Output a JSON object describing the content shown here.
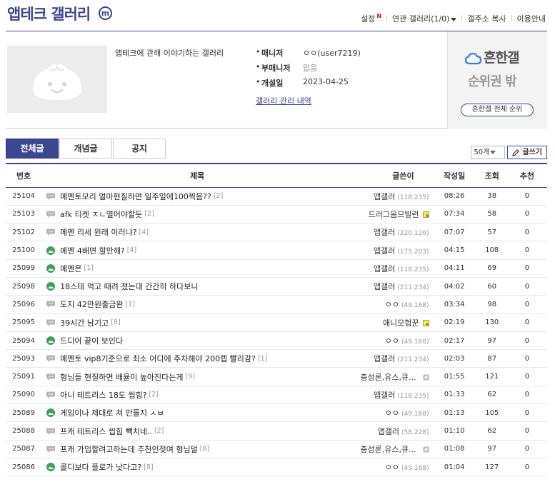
{
  "header": {
    "title": "앱테크 갤러리",
    "minor_badge": "m",
    "links": {
      "settings": "설정",
      "settings_badge": "N",
      "related": "연관 갤러리(1/0)",
      "copy_url": "갤주소 복사",
      "guide": "이용안내"
    }
  },
  "info": {
    "description": "앱테크에 관해 이야기하는 갤러리",
    "manager_label": "매니저",
    "manager_value": "ㅇㅇ(user7219)",
    "submanager_label": "부매니저",
    "submanager_value": "없음",
    "opened_label": "개설일",
    "opened_value": "2023-04-25",
    "manage_link": "갤러리 관리 내역"
  },
  "ranking": {
    "logo_text": "흔한갤",
    "rank_text": "순위권 밖",
    "button": "흔한갤 전체 순위"
  },
  "tabs": [
    {
      "label": "전체글",
      "active": true
    },
    {
      "label": "개념글",
      "active": false
    },
    {
      "label": "공지",
      "active": false
    }
  ],
  "list_tools": {
    "count": "50개",
    "write": "글쓰기"
  },
  "columns": {
    "num": "번호",
    "title": "제목",
    "writer": "글쓴이",
    "date": "작성일",
    "views": "조회",
    "recommend": "추천"
  },
  "colors": {
    "accent": "#3b4890",
    "green_icon": "#3ea05c",
    "gray_icon": "#b5b5b5"
  },
  "posts": [
    {
      "num": "25104",
      "icon": "text",
      "title": "메멘토모리 얼마현질하면 일주일에100찍음??",
      "replies": "[2]",
      "nick": "앱갤러",
      "ip": "(118.235)",
      "badge": "",
      "date": "08:26",
      "views": "38",
      "rec": "0"
    },
    {
      "num": "25103",
      "icon": "text",
      "title": "afk 티켓 ㅈㄴ열어야할듯",
      "replies": "[2]",
      "nick": "드러그옴므빌런",
      "ip": "",
      "badge": "fixed",
      "date": "07:34",
      "views": "58",
      "rec": "0"
    },
    {
      "num": "25102",
      "icon": "text",
      "title": "메멘 리세 원래 이러냐?",
      "replies": "[4]",
      "nick": "앱갤러",
      "ip": "(220.126)",
      "badge": "",
      "date": "07:07",
      "views": "57",
      "rec": "0"
    },
    {
      "num": "25100",
      "icon": "image",
      "title": "메멘 4배면 할만해?",
      "replies": "[4]",
      "nick": "앱갤러",
      "ip": "(175.203)",
      "badge": "",
      "date": "04:15",
      "views": "108",
      "rec": "0"
    },
    {
      "num": "25099",
      "icon": "image",
      "title": "메멘은",
      "replies": "[1]",
      "nick": "앱갤러",
      "ip": "(118.235)",
      "badge": "",
      "date": "04:11",
      "views": "69",
      "rec": "0"
    },
    {
      "num": "25098",
      "icon": "image",
      "title": "18스테 먹고 때려 쳤는대 간간히 하다보니",
      "replies": "",
      "nick": "앱갤러",
      "ip": "(211.234)",
      "badge": "",
      "date": "04:02",
      "views": "60",
      "rec": "0"
    },
    {
      "num": "25096",
      "icon": "text",
      "title": "도지 42만원출금완",
      "replies": "[1]",
      "nick": "ㅇㅇ",
      "ip": "(49.168)",
      "badge": "",
      "date": "03:34",
      "views": "98",
      "rec": "0"
    },
    {
      "num": "25095",
      "icon": "text",
      "title": "39시간 남기고",
      "replies": "[8]",
      "nick": "애니모험꾼",
      "ip": "",
      "badge": "fixed",
      "date": "02:19",
      "views": "130",
      "rec": "0"
    },
    {
      "num": "25094",
      "icon": "image",
      "title": "드디어 끝이 보인다",
      "replies": "",
      "nick": "ㅇㅇ",
      "ip": "(49.168)",
      "badge": "",
      "date": "02:17",
      "views": "97",
      "rec": "0"
    },
    {
      "num": "25093",
      "icon": "text",
      "title": "메멘토 vip8기준으로 최소 어디에 주차해야 200렙 빨리감?",
      "replies": "[1]",
      "nick": "앱갤러",
      "ip": "(211.234)",
      "badge": "",
      "date": "02:03",
      "views": "87",
      "rec": "0"
    },
    {
      "num": "25091",
      "icon": "text",
      "title": "형님들 현질하면 배율이 높아진다는게",
      "replies": "[9]",
      "nick": "충성론,유스,큐...",
      "ip": "",
      "badge": "half",
      "date": "01:55",
      "views": "121",
      "rec": "0"
    },
    {
      "num": "25090",
      "icon": "text",
      "title": "아니 테트리스 18도 씹힘?",
      "replies": "[2]",
      "nick": "앱갤러",
      "ip": "(118.235)",
      "badge": "",
      "date": "01:33",
      "views": "62",
      "rec": "0"
    },
    {
      "num": "25089",
      "icon": "image",
      "title": "게임이나 제대로 쳐 만들지 ㅅㅂ",
      "replies": "",
      "nick": "ㅇㅇ",
      "ip": "(49.168)",
      "badge": "",
      "date": "01:13",
      "views": "105",
      "rec": "0"
    },
    {
      "num": "25088",
      "icon": "text",
      "title": "프캐 테트리스 씹힘 빽치네..",
      "replies": "[2]",
      "nick": "앱갤러",
      "ip": "(58.228)",
      "badge": "",
      "date": "01:10",
      "views": "62",
      "rec": "0"
    },
    {
      "num": "25087",
      "icon": "text",
      "title": "프캐 가입할려고하는데 추천인젖여 형님덜",
      "replies": "[8]",
      "nick": "충성론,유스,큐...",
      "ip": "",
      "badge": "half",
      "date": "01:08",
      "views": "97",
      "rec": "0"
    },
    {
      "num": "25086",
      "icon": "image",
      "title": "콜디보다 플로가 낫다고?",
      "replies": "[8]",
      "nick": "ㅇㅇ",
      "ip": "(49.168)",
      "badge": "",
      "date": "01:04",
      "views": "127",
      "rec": "0"
    }
  ]
}
